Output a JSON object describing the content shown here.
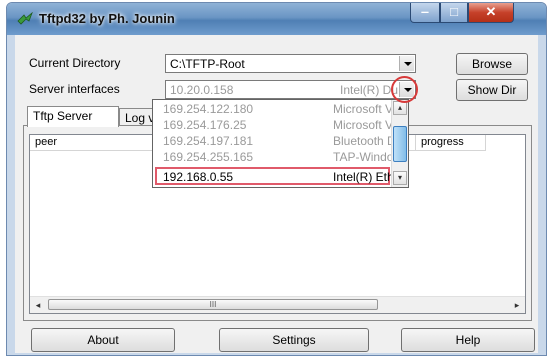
{
  "window": {
    "title": "Tftpd32 by Ph. Jounin",
    "icon": "tftp-app-icon",
    "controls": {
      "minimize": "‒",
      "maximize": "□",
      "close": "✕"
    }
  },
  "form": {
    "current_directory_label": "Current Directory",
    "current_directory_value": "C:\\TFTP-Root",
    "server_interfaces_label": "Server interfaces",
    "server_interfaces_ip": "10.20.0.158",
    "server_interfaces_nic": "Intel(R) Du",
    "browse_label": "Browse",
    "show_dir_label": "Show Dir"
  },
  "tabs": [
    {
      "label": "Tftp Server",
      "active": true
    },
    {
      "label": "Log v",
      "active": false
    }
  ],
  "table": {
    "columns": [
      "peer",
      "progress"
    ]
  },
  "dropdown": {
    "options": [
      {
        "ip": "169.254.122.180",
        "nic": "Microsoft V"
      },
      {
        "ip": "169.254.176.25",
        "nic": "Microsoft V"
      },
      {
        "ip": "169.254.197.181",
        "nic": "Bluetooth D"
      },
      {
        "ip": "169.254.255.165",
        "nic": "TAP-Windo"
      },
      {
        "ip": "192.168.0.55",
        "nic": "Intel(R) Eth",
        "selected": true
      }
    ]
  },
  "scroll_glyphs": {
    "left": "◂",
    "right": "▸",
    "up": "▴",
    "down": "▾",
    "grip": "III"
  },
  "footer": {
    "about_label": "About",
    "settings_label": "Settings",
    "help_label": "Help"
  },
  "colors": {
    "highlight": "#d83a3a",
    "selected_border": "#e05a6a",
    "titlebar": "#6a95c4"
  }
}
